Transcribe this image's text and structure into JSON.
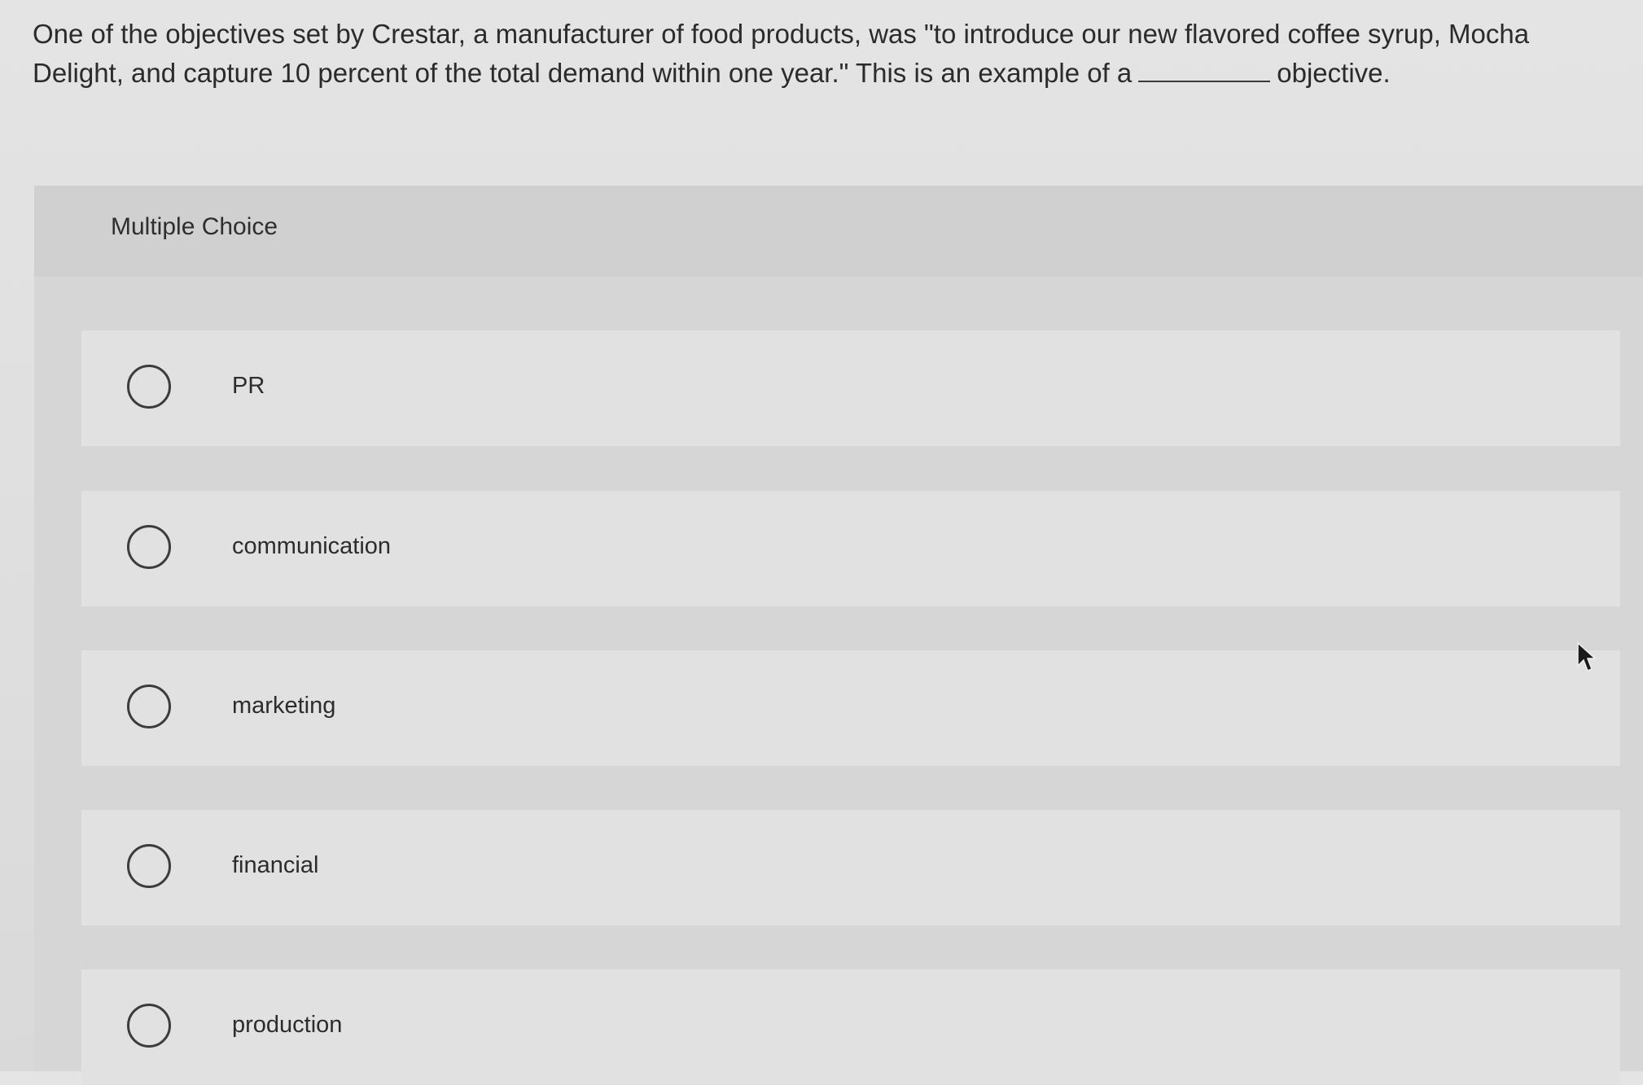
{
  "question": {
    "text_before": "One of the objectives set by Crestar, a manufacturer of food products, was \"to introduce our new flavored coffee syrup, Mocha Delight, and capture 10 percent of the total demand within one year.\" This is an example of a",
    "text_after": "objective."
  },
  "multiple_choice": {
    "header_label": "Multiple Choice",
    "options": [
      {
        "label": "PR",
        "selected": false
      },
      {
        "label": "communication",
        "selected": false
      },
      {
        "label": "marketing",
        "selected": false
      },
      {
        "label": "financial",
        "selected": false
      },
      {
        "label": "production",
        "selected": false
      }
    ]
  },
  "icons": {
    "radio": "radio-button-icon",
    "cursor": "mouse-pointer-icon"
  }
}
